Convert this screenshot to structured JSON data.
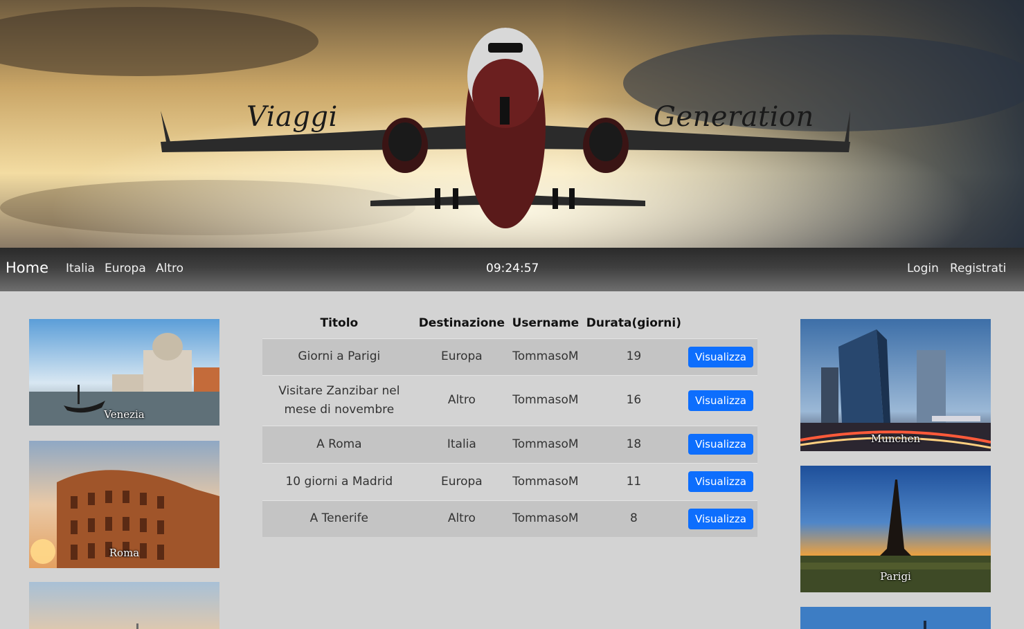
{
  "banner": {
    "title_left": "Viaggi",
    "title_right": "Generation"
  },
  "nav": {
    "brand": "Home",
    "links": [
      "Italia",
      "Europa",
      "Altro"
    ],
    "clock": "09:24:57",
    "login": "Login",
    "register": "Registrati"
  },
  "left_images": [
    {
      "caption": "Venezia"
    },
    {
      "caption": "Roma"
    },
    {
      "caption": ""
    }
  ],
  "right_images": [
    {
      "caption": "Munchen"
    },
    {
      "caption": "Parigi"
    },
    {
      "caption": ""
    }
  ],
  "table": {
    "headers": [
      "Titolo",
      "Destinazione",
      "Username",
      "Durata(giorni)",
      ""
    ],
    "rows": [
      {
        "titolo": "Giorni a Parigi",
        "destinazione": "Europa",
        "username": "TommasoM",
        "durata": "19",
        "action": "Visualizza"
      },
      {
        "titolo": "Visitare Zanzibar nel mese di novembre",
        "destinazione": "Altro",
        "username": "TommasoM",
        "durata": "16",
        "action": "Visualizza"
      },
      {
        "titolo": "A Roma",
        "destinazione": "Italia",
        "username": "TommasoM",
        "durata": "18",
        "action": "Visualizza"
      },
      {
        "titolo": "10 giorni a Madrid",
        "destinazione": "Europa",
        "username": "TommasoM",
        "durata": "11",
        "action": "Visualizza"
      },
      {
        "titolo": "A Tenerife",
        "destinazione": "Altro",
        "username": "TommasoM",
        "durata": "8",
        "action": "Visualizza"
      }
    ]
  },
  "colors": {
    "navbar": "#3f3f3f",
    "page_bg": "#d3d3d3",
    "button": "#0d6efd",
    "row_alt": "#c4c4c4"
  }
}
